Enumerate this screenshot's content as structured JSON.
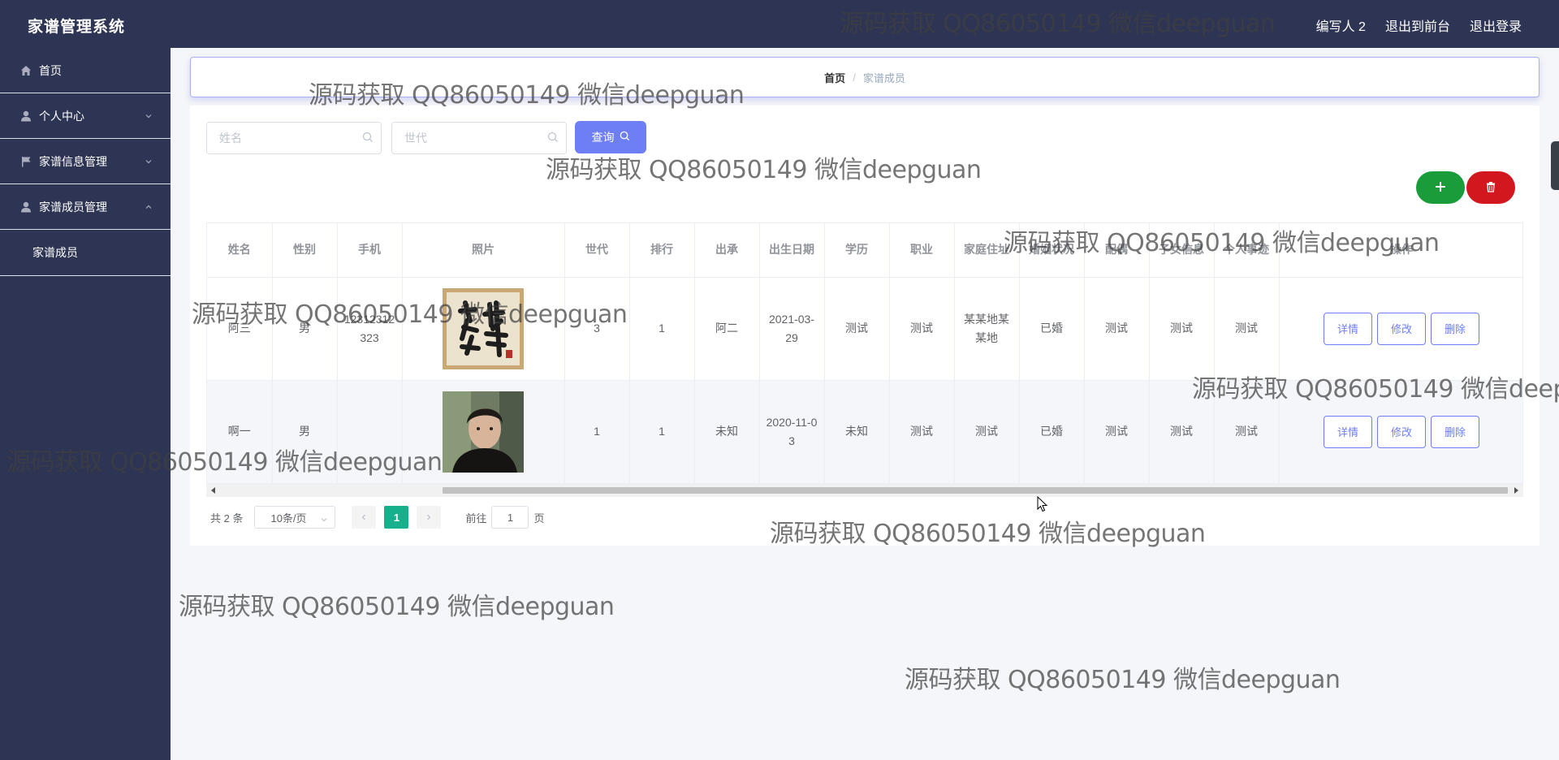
{
  "app": {
    "title": "家谱管理系统"
  },
  "topbar": {
    "user": "编写人 2",
    "front": "退出到前台",
    "logout": "退出登录"
  },
  "sidebar": {
    "items": [
      {
        "label": "首页",
        "icon": "home-icon"
      },
      {
        "label": "个人中心",
        "icon": "user-icon"
      },
      {
        "label": "家谱信息管理",
        "icon": "flag-icon"
      },
      {
        "label": "家谱成员管理",
        "icon": "user-icon"
      }
    ],
    "submenu": {
      "label": "家谱成员"
    }
  },
  "breadcrumb": {
    "home": "首页",
    "separator": "/",
    "current": "家谱成员"
  },
  "search": {
    "name_placeholder": "姓名",
    "generation_placeholder": "世代",
    "query_label": "查询"
  },
  "table": {
    "headers": [
      "姓名",
      "性别",
      "手机",
      "照片",
      "世代",
      "排行",
      "出承",
      "出生日期",
      "学历",
      "职业",
      "家庭住址",
      "婚姻状况",
      "配偶",
      "子女信息",
      "个人事迹",
      "操作"
    ],
    "rows": [
      {
        "name": "阿三",
        "gender": "男",
        "phone": "12312312323",
        "generation": "3",
        "rank": "1",
        "inherit": "阿二",
        "birth": "2021-03-29",
        "education": "测试",
        "job": "测试",
        "address": "某某地某某地",
        "marriage": "已婚",
        "spouse": "测试",
        "children": "测试",
        "deeds": "测试"
      },
      {
        "name": "啊一",
        "gender": "男",
        "phone": "",
        "generation": "1",
        "rank": "1",
        "inherit": "未知",
        "birth": "2020-11-03",
        "education": "未知",
        "job": "测试",
        "address": "测试",
        "marriage": "已婚",
        "spouse": "测试",
        "children": "测试",
        "deeds": "测试"
      }
    ],
    "ops": {
      "detail": "详情",
      "edit": "修改",
      "delete": "删除"
    }
  },
  "pagination": {
    "total": "共 2 条",
    "page_size": "10条/页",
    "current_page": "1",
    "goto_label": "前往",
    "goto_value": "1",
    "page_unit": "页"
  },
  "watermark": "源码获取 QQ86050149 微信deepguan",
  "colors": {
    "sidebar_bg": "#2e3453",
    "primary": "#6e7ff5",
    "success": "#1a9c3b",
    "danger": "#d2181e",
    "page_active": "#17b08c"
  }
}
